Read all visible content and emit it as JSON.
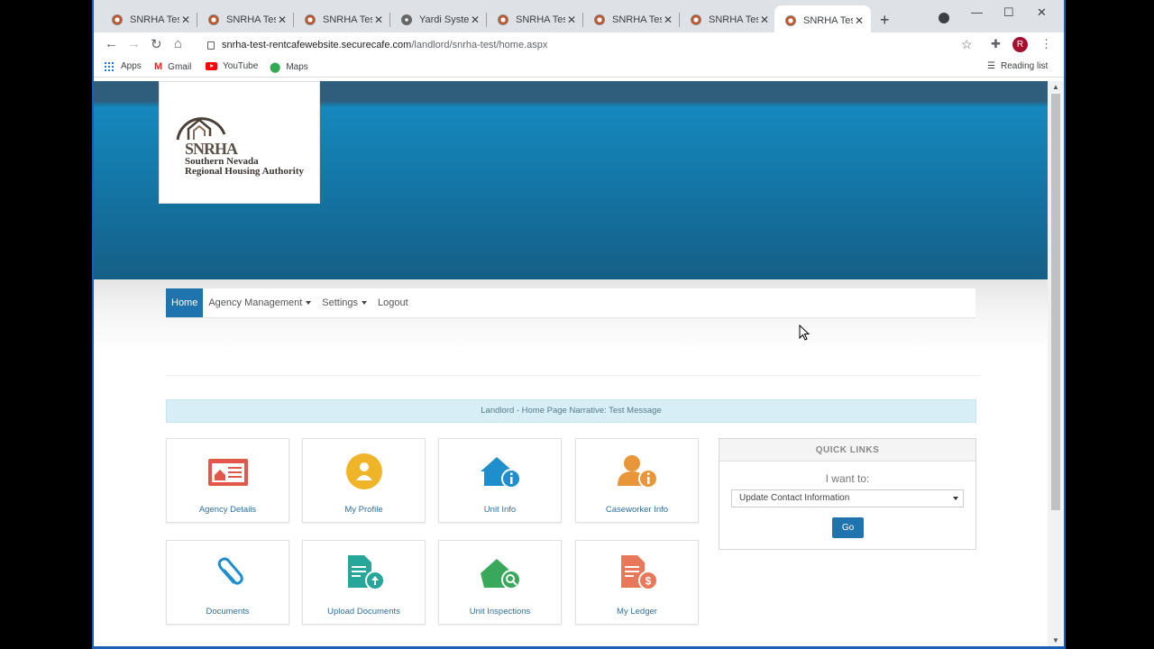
{
  "browser": {
    "tabs": [
      {
        "title": "SNRHA Test",
        "favicon": "rentcafe-icon",
        "active": false
      },
      {
        "title": "SNRHA Test",
        "favicon": "rentcafe-icon",
        "active": false
      },
      {
        "title": "SNRHA Test",
        "favicon": "rentcafe-icon",
        "active": false
      },
      {
        "title": "Yardi Systems",
        "favicon": "globe-icon",
        "active": false
      },
      {
        "title": "SNRHA Test",
        "favicon": "rentcafe-icon",
        "active": false
      },
      {
        "title": "SNRHA Test",
        "favicon": "rentcafe-icon",
        "active": false
      },
      {
        "title": "SNRHA Test",
        "favicon": "rentcafe-icon",
        "active": false
      },
      {
        "title": "SNRHA Test",
        "favicon": "rentcafe-icon",
        "active": true
      }
    ],
    "url_host": "snrha-test-rentcafewebsite.securecafe.com",
    "url_path": "/landlord/snrha-test/home.aspx",
    "profile_initial": "R",
    "bookmarks": [
      {
        "label": "Apps",
        "icon": "apps-grid-icon"
      },
      {
        "label": "Gmail",
        "icon": "gmail-icon"
      },
      {
        "label": "YouTube",
        "icon": "youtube-icon"
      },
      {
        "label": "Maps",
        "icon": "maps-pin-icon"
      }
    ],
    "reading_list": "Reading list"
  },
  "logo": {
    "acronym": "SNRHA",
    "line1": "Southern Nevada",
    "line2": "Regional Housing Authority"
  },
  "nav": {
    "items": [
      {
        "label": "Home",
        "active": true,
        "dropdown": false
      },
      {
        "label": "Agency Management",
        "active": false,
        "dropdown": true
      },
      {
        "label": "Settings",
        "active": false,
        "dropdown": true
      },
      {
        "label": "Logout",
        "active": false,
        "dropdown": false
      }
    ]
  },
  "narrative": "Landlord - Home Page Narrative: Test Message",
  "tiles": [
    {
      "label": "Agency Details",
      "icon": "agency-details-icon",
      "color": "#e2574c"
    },
    {
      "label": "My Profile",
      "icon": "profile-icon",
      "color": "#f0b429"
    },
    {
      "label": "Unit Info",
      "icon": "unit-info-icon",
      "color": "#1f8ecd"
    },
    {
      "label": "Caseworker Info",
      "icon": "caseworker-icon",
      "color": "#e8963a"
    },
    {
      "label": "Documents",
      "icon": "paperclip-icon",
      "color": "#1f8ecd"
    },
    {
      "label": "Upload Documents",
      "icon": "upload-document-icon",
      "color": "#27a79a"
    },
    {
      "label": "Unit Inspections",
      "icon": "unit-inspection-icon",
      "color": "#3aa85a"
    },
    {
      "label": "My Ledger",
      "icon": "ledger-icon",
      "color": "#e8785a"
    }
  ],
  "quick_links": {
    "heading": "QUICK LINKS",
    "prompt": "I want to:",
    "selected": "Update Contact Information",
    "go_label": "Go"
  },
  "colors": {
    "banner": "#1477a8",
    "nav_active": "#1f74ae",
    "link": "#2f6f9f"
  }
}
